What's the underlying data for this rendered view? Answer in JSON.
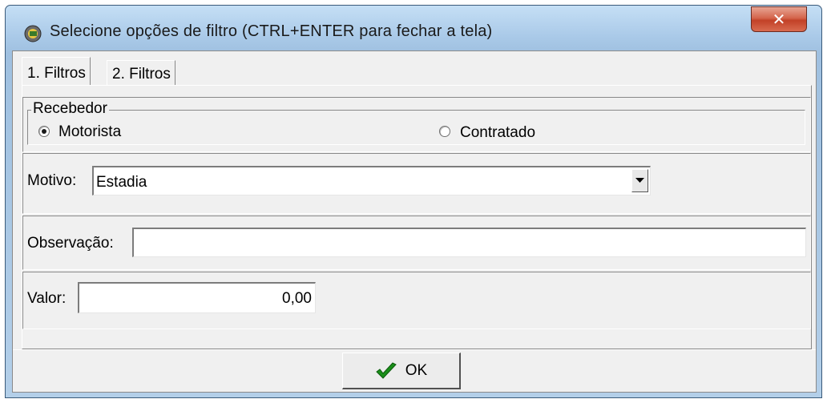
{
  "window": {
    "title": "Selecione opções de filtro (CTRL+ENTER para fechar a tela)",
    "close_glyph": "✕"
  },
  "tabs": [
    {
      "label": "1. Filtros",
      "active": true
    },
    {
      "label": "2. Filtros",
      "active": false
    }
  ],
  "recebedor": {
    "group_label": "Recebedor",
    "options": [
      {
        "label": "Motorista",
        "selected": true
      },
      {
        "label": "Contratado",
        "selected": false
      }
    ]
  },
  "motivo": {
    "label": "Motivo:",
    "value": "Estadia"
  },
  "observacao": {
    "label": "Observação:",
    "value": ""
  },
  "valor": {
    "label": "Valor:",
    "value": "0,00"
  },
  "ok_button": {
    "label": "OK"
  },
  "colors": {
    "check_green": "#1a8f1a",
    "close_red": "#c24127"
  },
  "icons": {
    "app": "app-icon",
    "close": "close-icon",
    "dropdown": "chevron-down-icon",
    "ok": "checkmark-icon"
  }
}
